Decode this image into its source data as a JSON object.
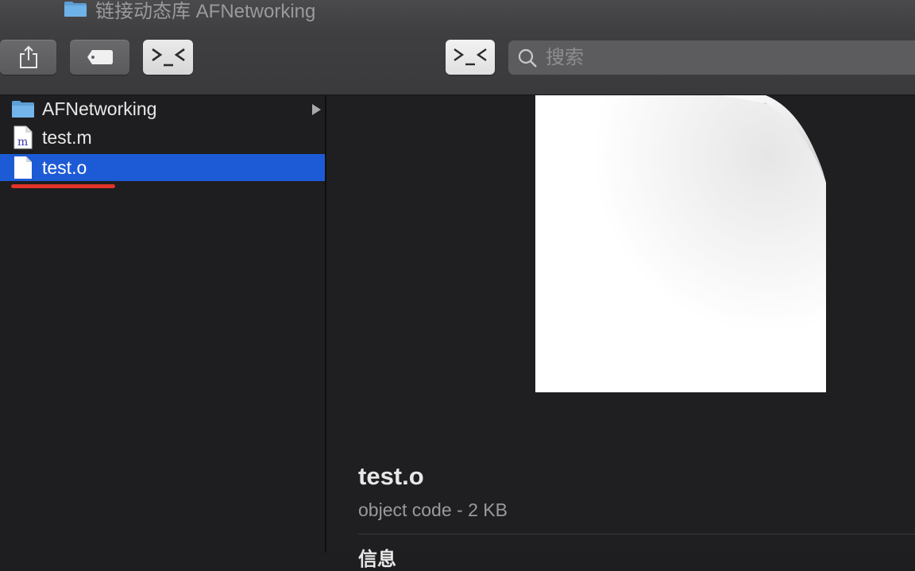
{
  "window": {
    "title": "链接动态库 AFNetworking"
  },
  "toolbar": {
    "share_icon": "share-icon",
    "tag_icon": "tag-icon",
    "terminal_icon": "terminal-face-icon"
  },
  "search": {
    "placeholder": "搜索",
    "value": ""
  },
  "sidebar": {
    "items": [
      {
        "label": "AFNetworking",
        "icon": "folder-icon",
        "has_children": true,
        "selected": false
      },
      {
        "label": "test.m",
        "icon": "objc-source-file-icon",
        "has_children": false,
        "selected": false
      },
      {
        "label": "test.o",
        "icon": "blank-document-icon",
        "has_children": false,
        "selected": true
      }
    ]
  },
  "preview": {
    "name": "test.o",
    "kind": "object code - 2 KB",
    "section_heading": "信息"
  },
  "colors": {
    "selection": "#1d5bd6",
    "annotation_underline": "#e0332a",
    "background": "#1e1e20"
  }
}
